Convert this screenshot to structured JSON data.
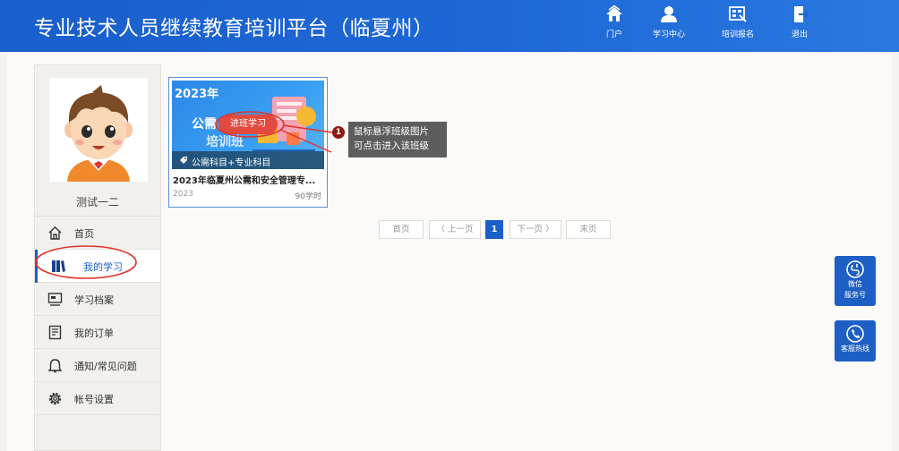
{
  "header": {
    "title": "专业技术人员继续教育培训平台（临夏州）",
    "nav": [
      {
        "label": "门户",
        "icon": "home-icon"
      },
      {
        "label": "学习中心",
        "icon": "user-icon"
      },
      {
        "label": "培训报名",
        "icon": "register-icon"
      },
      {
        "label": "退出",
        "icon": "logout-icon"
      }
    ]
  },
  "sidebar": {
    "user_name": "测试一二",
    "items": [
      {
        "label": "首页",
        "icon": "home-icon"
      },
      {
        "label": "我的学习",
        "icon": "book-icon",
        "active": true
      },
      {
        "label": "学习档案",
        "icon": "archive-icon"
      },
      {
        "label": "我的订单",
        "icon": "order-icon"
      },
      {
        "label": "通知/常见问题",
        "icon": "bell-icon"
      },
      {
        "label": "帐号设置",
        "icon": "gear-icon"
      }
    ]
  },
  "course_card": {
    "image_year": "2023年",
    "image_text_1": "公需",
    "image_text_2": "培训班",
    "enter_label": "进班学习",
    "tag": "公需科目+专业科目",
    "title": "2023年临夏州公需和安全管理专...",
    "year": "2023",
    "hours": "90学时"
  },
  "annotation": {
    "number": "1",
    "text_line1": "鼠标悬浮班级图片",
    "text_line2": "可点击进入该班级"
  },
  "pagination": {
    "first": "首页",
    "prev": "〈 上一页",
    "current": "1",
    "next": "下一页 〉",
    "last": "末页"
  },
  "float": {
    "wechat_line1": "微信",
    "wechat_line2": "服务号",
    "hotline": "客服热线"
  },
  "colors": {
    "header": "#1d68d6",
    "accent": "#1a5fcc",
    "annotation": "#e24a3f"
  }
}
